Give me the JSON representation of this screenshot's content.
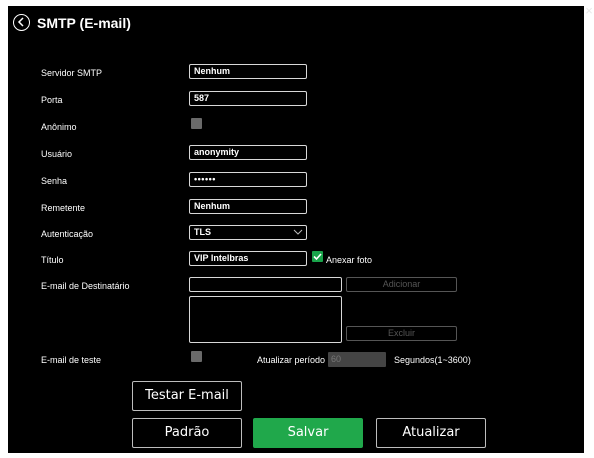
{
  "header": {
    "title": "SMTP (E-mail)",
    "close": "×"
  },
  "form": {
    "server_label": "Servidor SMTP",
    "server_value": "Nenhum",
    "port_label": "Porta",
    "port_value": "587",
    "anonymous_label": "Anônimo",
    "anonymous_checked": false,
    "user_label": "Usuário",
    "user_value": "anonymity",
    "password_label": "Senha",
    "password_value": "••••••",
    "sender_label": "Remetente",
    "sender_value": "Nenhum",
    "auth_label": "Autenticação",
    "auth_value": "TLS",
    "subject_label": "Título",
    "subject_value": "VIP Intelbras",
    "attach_label": "Anexar foto",
    "attach_checked": true,
    "recipient_label": "E-mail de Destinatário",
    "recipient_value": "",
    "add_label": "Adicionar",
    "delete_label": "Excluir",
    "test_label": "E-mail de teste",
    "test_checked": false,
    "period_label": "Atualizar período",
    "period_value": "60",
    "period_unit": "Segundos(1~3600)"
  },
  "buttons": {
    "test_email": "Testar E-mail",
    "default": "Padrão",
    "save": "Salvar",
    "refresh": "Atualizar"
  },
  "colors": {
    "accent": "#20a84b",
    "background": "#000000",
    "text": "#ffffff"
  }
}
